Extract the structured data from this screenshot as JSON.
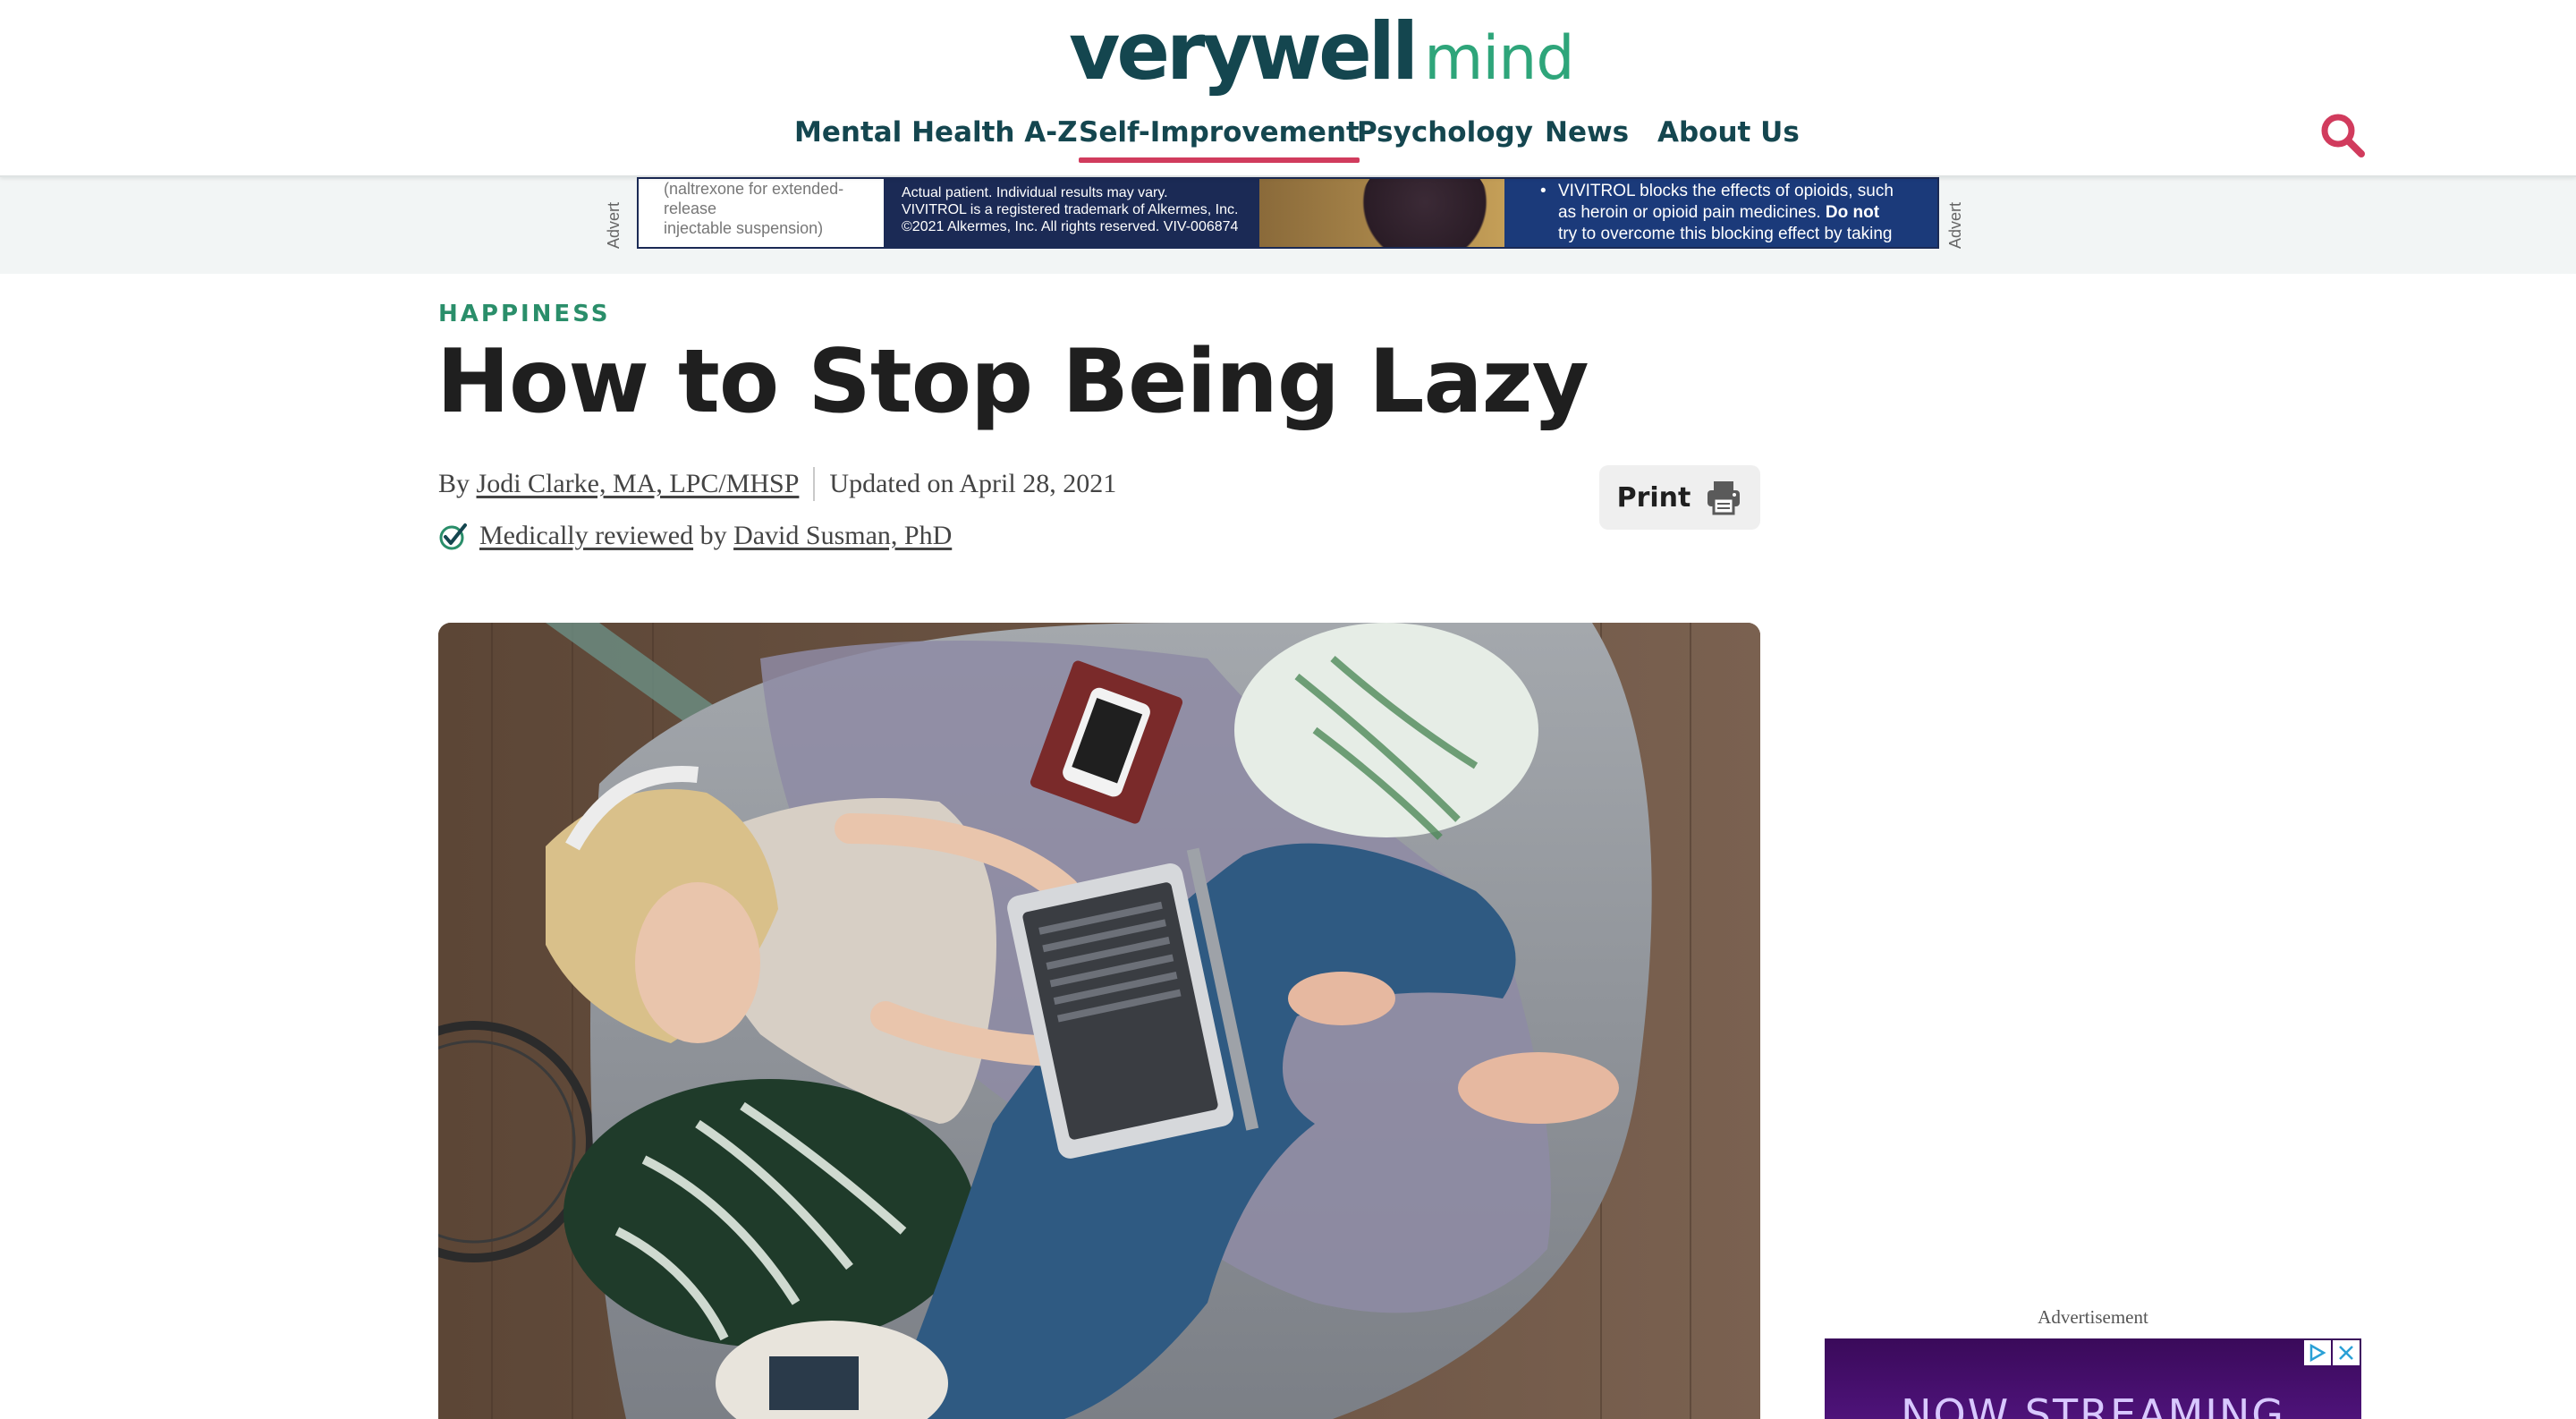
{
  "site": {
    "logo_primary": "verywell",
    "logo_secondary": "mind",
    "brand_dark": "#14464f",
    "brand_green": "#2ea57a",
    "accent_red": "#d13b5d"
  },
  "nav": {
    "items": [
      {
        "label": "Mental Health A-Z"
      },
      {
        "label": "Self-Improvement"
      },
      {
        "label": "Psychology"
      },
      {
        "label": "News"
      },
      {
        "label": "About Us"
      }
    ],
    "active_index": 1,
    "search_icon": "search-icon"
  },
  "top_ad": {
    "side_label": "Advert",
    "col1_lines": [
      "(naltrexone for extended-release",
      "injectable suspension)"
    ],
    "col2_lines": [
      "Actual patient. Individual results may vary.",
      "VIVITROL is a registered trademark of Alkermes, Inc.",
      "©2021 Alkermes, Inc. All rights reserved. VIV-006874"
    ],
    "col4_line1": "VIVITROL blocks the effects of opioids, such",
    "col4_line2a": "as heroin or opioid pain medicines. ",
    "col4_line2b": "Do not",
    "col4_line3": "try to overcome this blocking effect by taking"
  },
  "article": {
    "category": "HAPPINESS",
    "title": "How to Stop Being Lazy",
    "by_prefix": "By ",
    "author": "Jodi Clarke, MA, LPC/MHSP",
    "updated": "Updated on April 28, 2021",
    "reviewed_link": "Medically reviewed",
    "reviewed_by": " by ",
    "reviewer": "David Susman, PhD",
    "print_label": "Print"
  },
  "rail_ad": {
    "label": "Advertisement",
    "text": "NOW STREAMING"
  }
}
